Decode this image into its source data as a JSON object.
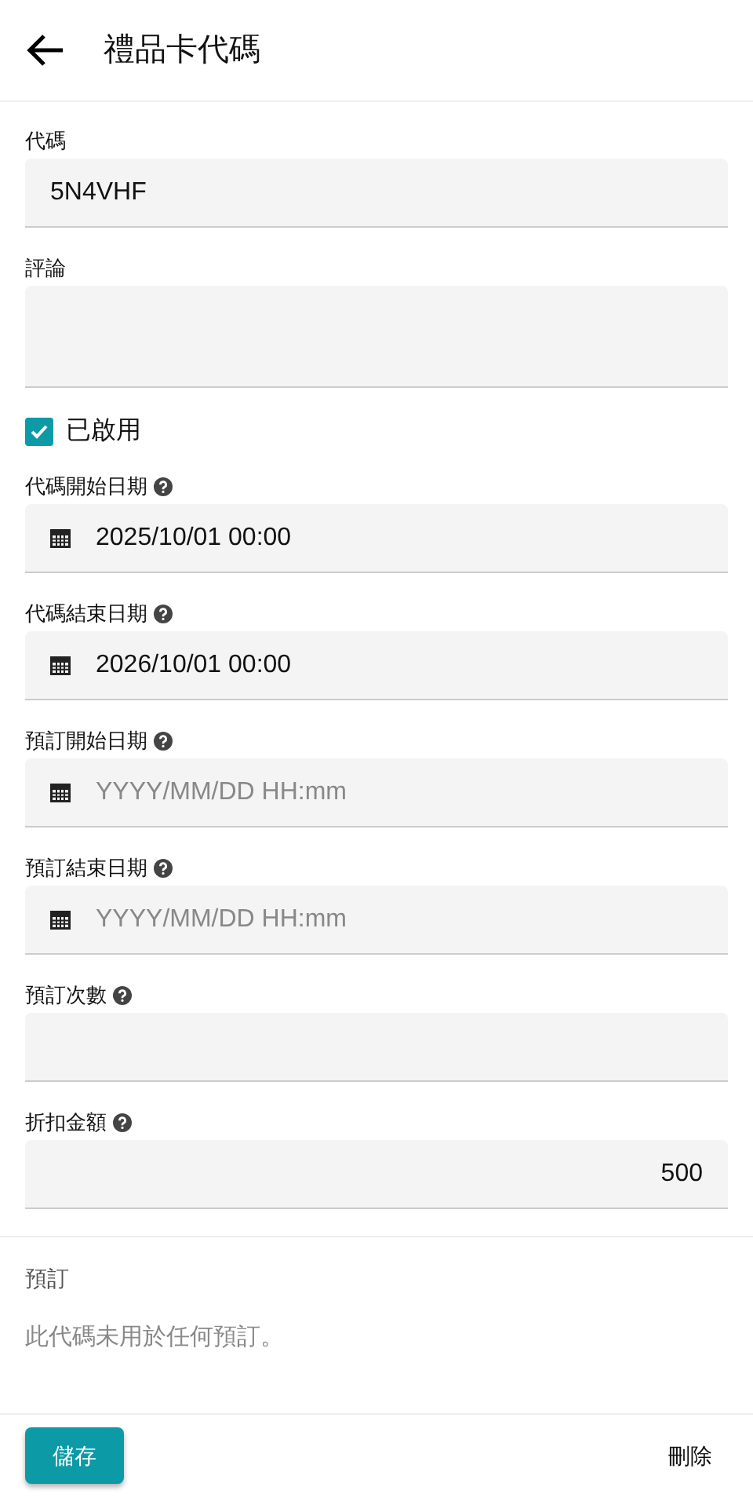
{
  "header": {
    "title": "禮品卡代碼"
  },
  "fields": [
    {
      "kind": "text",
      "label": "代碼",
      "value": "5N4VHF",
      "help": false
    },
    {
      "kind": "textarea",
      "label": "評論",
      "help": false
    },
    {
      "kind": "checkbox",
      "label": "已啟用",
      "checked": true
    },
    {
      "kind": "date",
      "label": "代碼開始日期",
      "value": "2025/10/01 00:00",
      "help": true
    },
    {
      "kind": "date",
      "label": "代碼結束日期",
      "value": "2026/10/01 00:00",
      "help": true
    },
    {
      "kind": "date",
      "label": "預訂開始日期",
      "placeholder": "YYYY/MM/DD HH:mm",
      "help": true
    },
    {
      "kind": "date",
      "label": "預訂結束日期",
      "placeholder": "YYYY/MM/DD HH:mm",
      "help": true
    },
    {
      "kind": "number",
      "label": "預訂次數",
      "help": true
    },
    {
      "kind": "number",
      "label": "折扣金額",
      "value": "500",
      "help": true
    }
  ],
  "bookings": {
    "title": "預訂",
    "message": "此代碼未用於任何預訂。"
  },
  "footer": {
    "save": "儲存",
    "delete": "刪除"
  }
}
